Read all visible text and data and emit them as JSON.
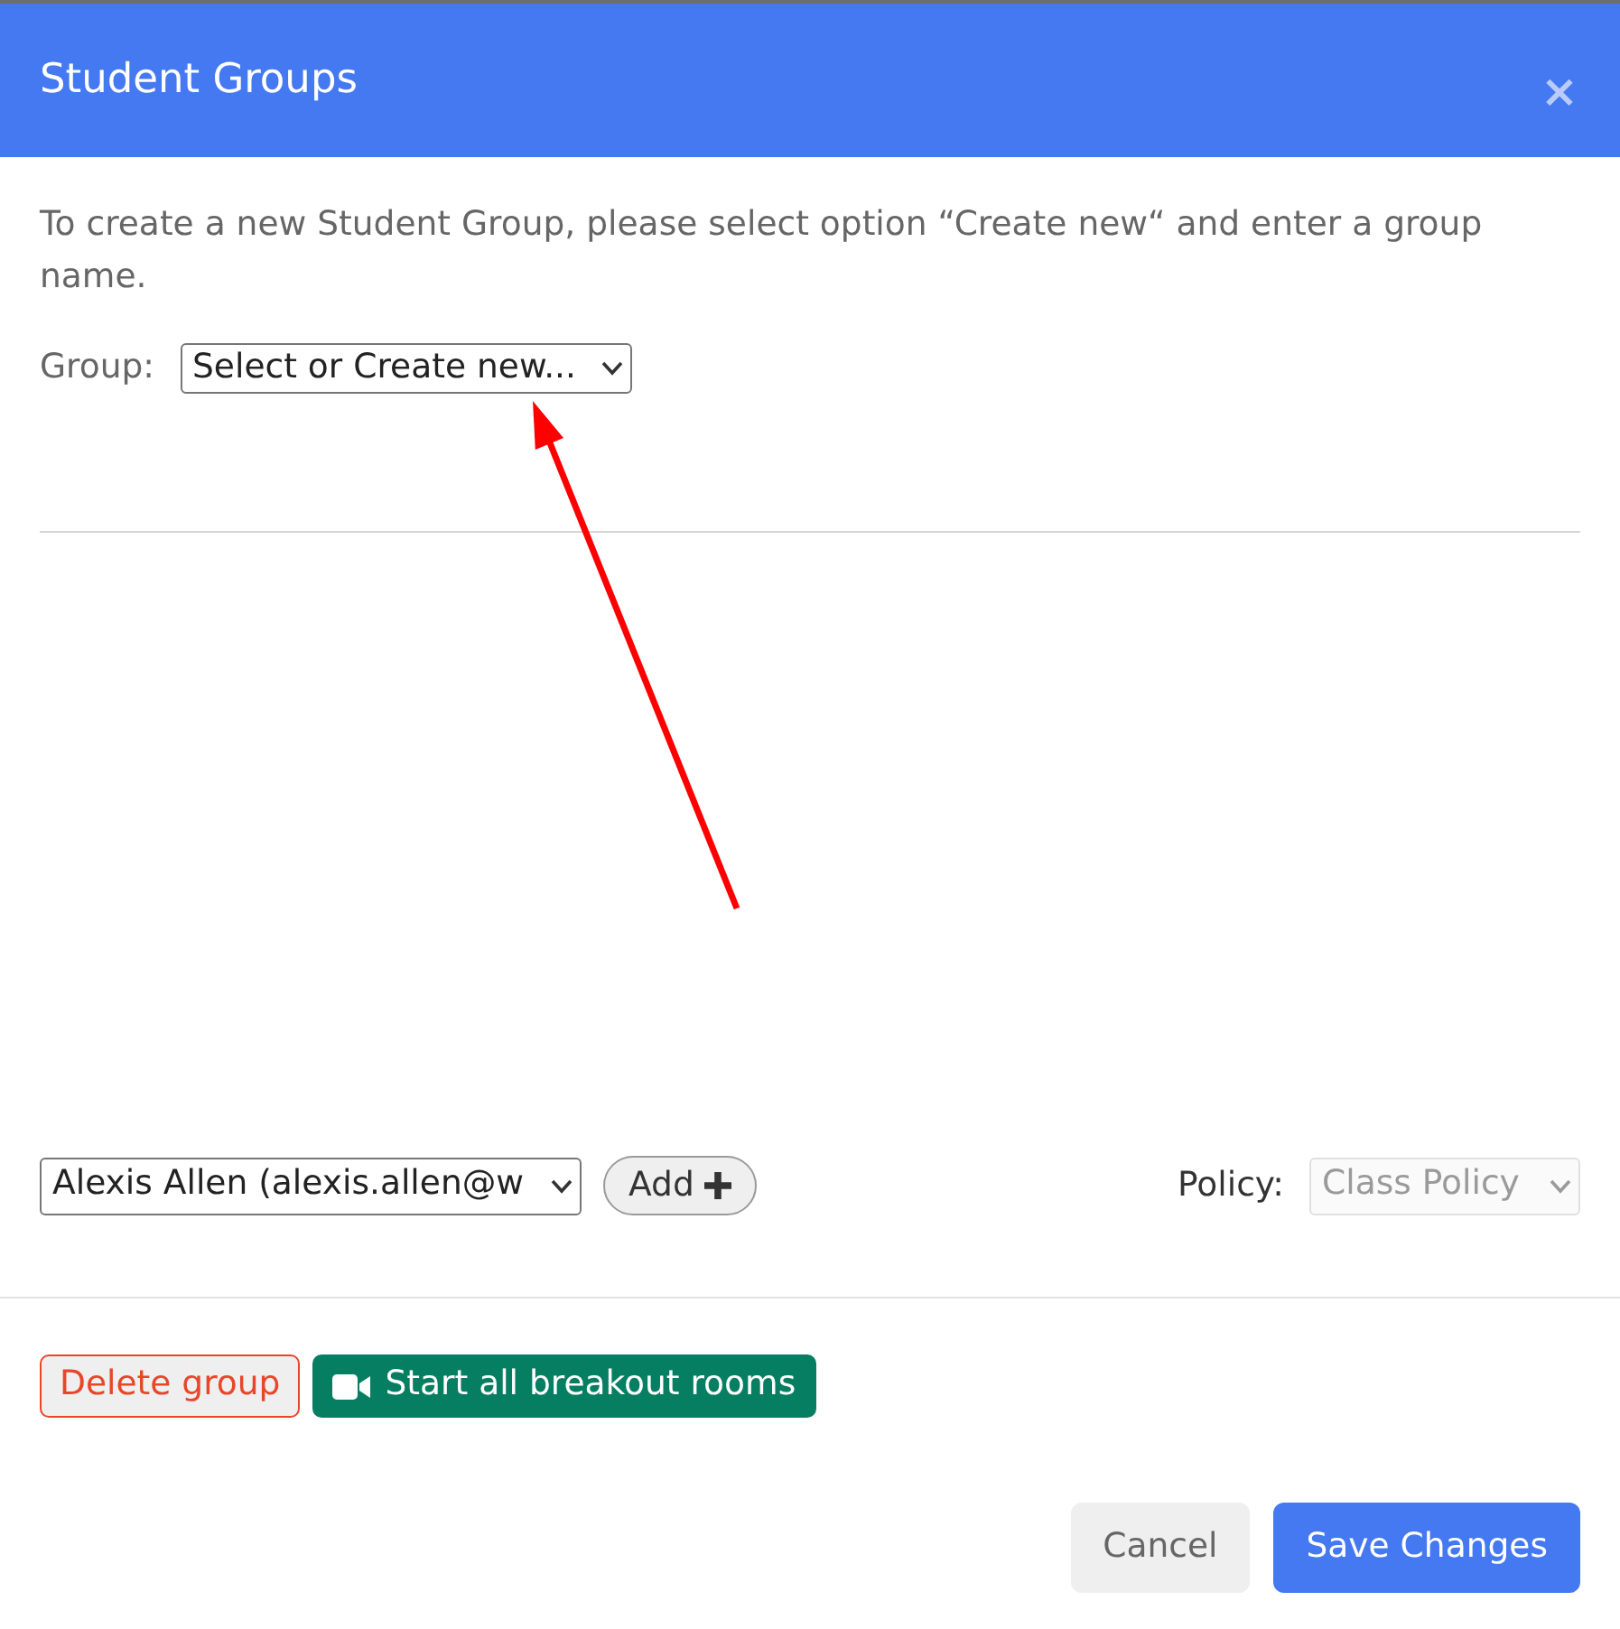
{
  "dialog": {
    "title": "Student Groups",
    "close_label": "×"
  },
  "instructions": "To create a new Student Group, please select option “Create new“ and enter a group name.",
  "group_field": {
    "label": "Group:",
    "value": "Select or Create new..."
  },
  "annotations": [
    {
      "kind": "arrow"
    }
  ],
  "member_picker": {
    "value": "Alexis Allen (alexis.allen@w",
    "add_label": "Add"
  },
  "policy_field": {
    "label": "Policy:",
    "value": "Class Policy",
    "disabled": true
  },
  "group_actions": [
    {
      "kind": "delete",
      "label": "Delete group"
    },
    {
      "kind": "start_rooms",
      "label": "Start all breakout rooms"
    }
  ],
  "footer_buttons": [
    {
      "kind": "cancel",
      "label": "Cancel"
    },
    {
      "kind": "save",
      "label": "Save Changes"
    }
  ]
}
